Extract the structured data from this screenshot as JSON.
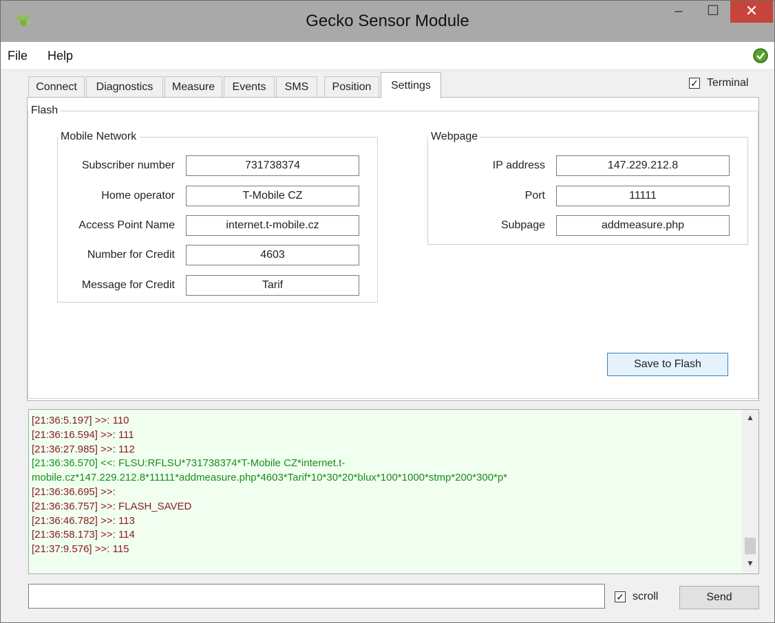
{
  "window": {
    "title": "Gecko Sensor Module",
    "controls": {
      "minimize": "–",
      "maximize": "☐",
      "close": "✕"
    }
  },
  "menu": [
    "File",
    "Help"
  ],
  "tabs": [
    "Connect",
    "Diagnostics",
    "Measure",
    "Events",
    "SMS",
    "Position",
    "Settings"
  ],
  "active_tab": "Settings",
  "terminal_checkbox": {
    "label": "Terminal",
    "checked": true
  },
  "settings": {
    "flash_group": "Flash",
    "mobile_network": {
      "title": "Mobile Network",
      "rows": [
        {
          "label": "Subscriber number",
          "value": "731738374"
        },
        {
          "label": "Home operator",
          "value": "T-Mobile CZ"
        },
        {
          "label": "Access Point Name",
          "value": "internet.t-mobile.cz"
        },
        {
          "label": "Number for Credit",
          "value": "4603"
        },
        {
          "label": "Message for Credit",
          "value": "Tarif"
        }
      ]
    },
    "webpage": {
      "title": "Webpage",
      "rows": [
        {
          "label": "IP address",
          "value": "147.229.212.8"
        },
        {
          "label": "Port",
          "value": "11111"
        },
        {
          "label": "Subpage",
          "value": "addmeasure.php"
        }
      ]
    },
    "save_button": "Save to Flash"
  },
  "log": [
    {
      "text": "[21:36:5.197] >>: 110",
      "dir": "in"
    },
    {
      "text": "[21:36:16.594] >>: 111",
      "dir": "in"
    },
    {
      "text": "[21:36:27.985] >>: 112",
      "dir": "in"
    },
    {
      "text": "[21:36:36.570] <<: FLSU:RFLSU*731738374*T-Mobile CZ*internet.t-mobile.cz*147.229.212.8*11111*addmeasure.php*4603*Tarif*10*30*20*blux*100*1000*stmp*200*300*p*",
      "dir": "out"
    },
    {
      "text": "[21:36:36.695] >>:",
      "dir": "in"
    },
    {
      "text": "[21:36:36.757] >>: FLASH_SAVED",
      "dir": "in"
    },
    {
      "text": "[21:36:46.782] >>: 113",
      "dir": "in"
    },
    {
      "text": "[21:36:58.173] >>: 114",
      "dir": "in"
    },
    {
      "text": "[21:37:9.576] >>: 115",
      "dir": "in"
    }
  ],
  "bottom": {
    "send_input_value": "",
    "scroll_checkbox": {
      "label": "scroll",
      "checked": true
    },
    "send_button": "Send"
  },
  "colors": {
    "log_in": "#8b1a1a",
    "log_out": "#1a8c1a",
    "log_bg": "#f0fff0",
    "close_button": "#c7443a"
  }
}
